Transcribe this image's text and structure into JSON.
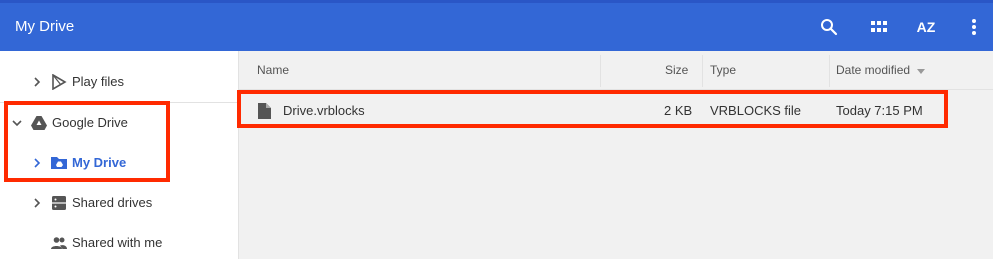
{
  "app": {
    "title": "My Drive"
  },
  "toolbar": {
    "icons": [
      "search-icon",
      "grid-view-icon",
      "sort-az-icon",
      "more-vert-icon"
    ],
    "sort_label": "AZ"
  },
  "sidebar": {
    "items": [
      {
        "label": "Play files",
        "icon": "play-files-icon",
        "expandable": true,
        "expanded": false,
        "active": false
      },
      {
        "label": "Google Drive",
        "icon": "google-drive-icon",
        "expandable": true,
        "expanded": true,
        "active": false
      },
      {
        "label": "My Drive",
        "icon": "my-drive-folder-icon",
        "expandable": true,
        "expanded": false,
        "active": true
      },
      {
        "label": "Shared drives",
        "icon": "shared-drives-icon",
        "expandable": true,
        "expanded": false,
        "active": false
      },
      {
        "label": "Shared with me",
        "icon": "shared-with-me-icon",
        "expandable": false,
        "expanded": false,
        "active": false
      }
    ]
  },
  "table": {
    "columns": [
      "Name",
      "Size",
      "Type",
      "Date modified"
    ],
    "sort_column": "Date modified",
    "sort_direction": "descending",
    "rows": [
      {
        "name": "Drive.vrblocks",
        "size": "2 KB",
        "type": "VRBLOCKS file",
        "date": "Today 7:15 PM",
        "icon": "file-icon"
      }
    ]
  },
  "colors": {
    "accent": "#3367d6",
    "highlight_box": "#ff2a00"
  }
}
